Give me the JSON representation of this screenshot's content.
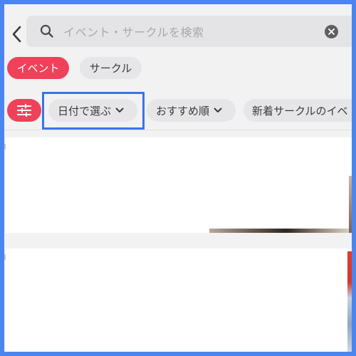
{
  "header": {
    "back_icon": "chevron-left-icon",
    "search": {
      "placeholder": "イベント・サークルを検索",
      "search_icon": "search-icon",
      "clear_icon": "clear-circle-icon"
    }
  },
  "tabs": [
    {
      "label": "イベント",
      "active": true
    },
    {
      "label": "サークル",
      "active": false
    }
  ],
  "filters": {
    "filter_icon": "sliders-icon",
    "chips": [
      {
        "label": "日付で選ぶ",
        "icon": "chevron-down-icon"
      },
      {
        "label": "おすすめ順",
        "icon": "chevron-down-icon"
      },
      {
        "label": "新着サークルのイベ"
      }
    ]
  },
  "colors": {
    "accent": "#f0415a",
    "highlight": "#3b74e6",
    "frame": "#4b86f0",
    "chip_bg": "#e6e6e8"
  }
}
